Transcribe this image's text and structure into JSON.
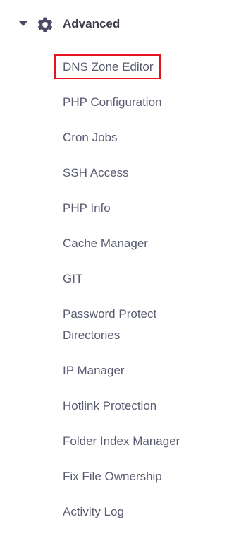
{
  "section": {
    "title": "Advanced",
    "caret_icon": "caret-down-icon",
    "icon": "gear-icon"
  },
  "menu": {
    "items": [
      {
        "label": "DNS Zone Editor",
        "highlighted": true
      },
      {
        "label": "PHP Configuration"
      },
      {
        "label": "Cron Jobs"
      },
      {
        "label": "SSH Access"
      },
      {
        "label": "PHP Info"
      },
      {
        "label": "Cache Manager"
      },
      {
        "label": "GIT"
      },
      {
        "label": "Password Protect Directories"
      },
      {
        "label": "IP Manager"
      },
      {
        "label": "Hotlink Protection"
      },
      {
        "label": "Folder Index Manager"
      },
      {
        "label": "Fix File Ownership"
      },
      {
        "label": "Activity Log"
      }
    ]
  },
  "colors": {
    "text": "#595b70",
    "title": "#3b3d4a",
    "icon": "#4b4c63",
    "highlight_border": "#e5121e"
  }
}
